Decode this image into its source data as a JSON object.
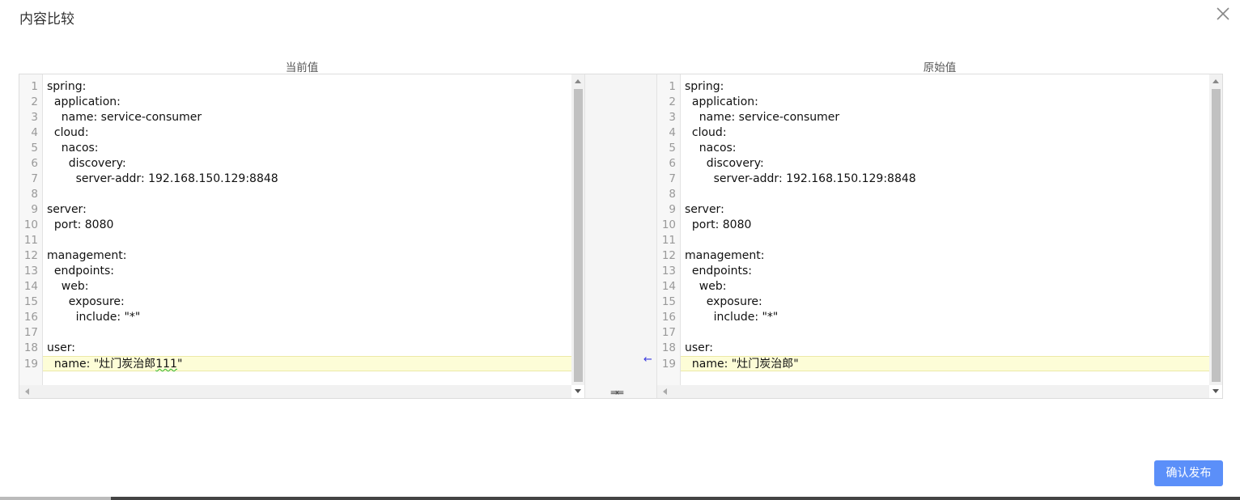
{
  "dialog": {
    "title": "内容比较",
    "close_icon": "close-icon"
  },
  "left_pane": {
    "title": "当前值",
    "lines": [
      {
        "num": "1",
        "text": "spring:"
      },
      {
        "num": "2",
        "text": "  application:"
      },
      {
        "num": "3",
        "text": "    name: service-consumer"
      },
      {
        "num": "4",
        "text": "  cloud:"
      },
      {
        "num": "5",
        "text": "    nacos:"
      },
      {
        "num": "6",
        "text": "      discovery:"
      },
      {
        "num": "7",
        "text": "        server-addr: 192.168.150.129:8848"
      },
      {
        "num": "8",
        "text": ""
      },
      {
        "num": "9",
        "text": "server:"
      },
      {
        "num": "10",
        "text": "  port: 8080"
      },
      {
        "num": "11",
        "text": ""
      },
      {
        "num": "12",
        "text": "management:"
      },
      {
        "num": "13",
        "text": "  endpoints:"
      },
      {
        "num": "14",
        "text": "    web:"
      },
      {
        "num": "15",
        "text": "      exposure:"
      },
      {
        "num": "16",
        "text": "        include: \"*\""
      },
      {
        "num": "17",
        "text": ""
      },
      {
        "num": "18",
        "text": "user:"
      },
      {
        "num": "19",
        "text_before": "  name: \"灶门炭治郎",
        "text_squiggle": "111",
        "text_after": "\""
      }
    ]
  },
  "right_pane": {
    "title": "原始值",
    "lines": [
      {
        "num": "1",
        "text": "spring:"
      },
      {
        "num": "2",
        "text": "  application:"
      },
      {
        "num": "3",
        "text": "    name: service-consumer"
      },
      {
        "num": "4",
        "text": "  cloud:"
      },
      {
        "num": "5",
        "text": "    nacos:"
      },
      {
        "num": "6",
        "text": "      discovery:"
      },
      {
        "num": "7",
        "text": "        server-addr: 192.168.150.129:8848"
      },
      {
        "num": "8",
        "text": ""
      },
      {
        "num": "9",
        "text": "server:"
      },
      {
        "num": "10",
        "text": "  port: 8080"
      },
      {
        "num": "11",
        "text": ""
      },
      {
        "num": "12",
        "text": "management:"
      },
      {
        "num": "13",
        "text": "  endpoints:"
      },
      {
        "num": "14",
        "text": "    web:"
      },
      {
        "num": "15",
        "text": "      exposure:"
      },
      {
        "num": "16",
        "text": "        include: \"*\""
      },
      {
        "num": "17",
        "text": ""
      },
      {
        "num": "18",
        "text": "user:"
      },
      {
        "num": "19",
        "text": "  name: \"灶门炭治郎\""
      }
    ]
  },
  "merge_gap": {
    "revert_arrow": "←",
    "swap_icon": "⇛⇚"
  },
  "footer": {
    "confirm_label": "确认发布"
  },
  "colors": {
    "accent": "#5b8ff9",
    "changed_line_bg": "#fdfdd7",
    "revert_arrow": "#3a3adf"
  }
}
